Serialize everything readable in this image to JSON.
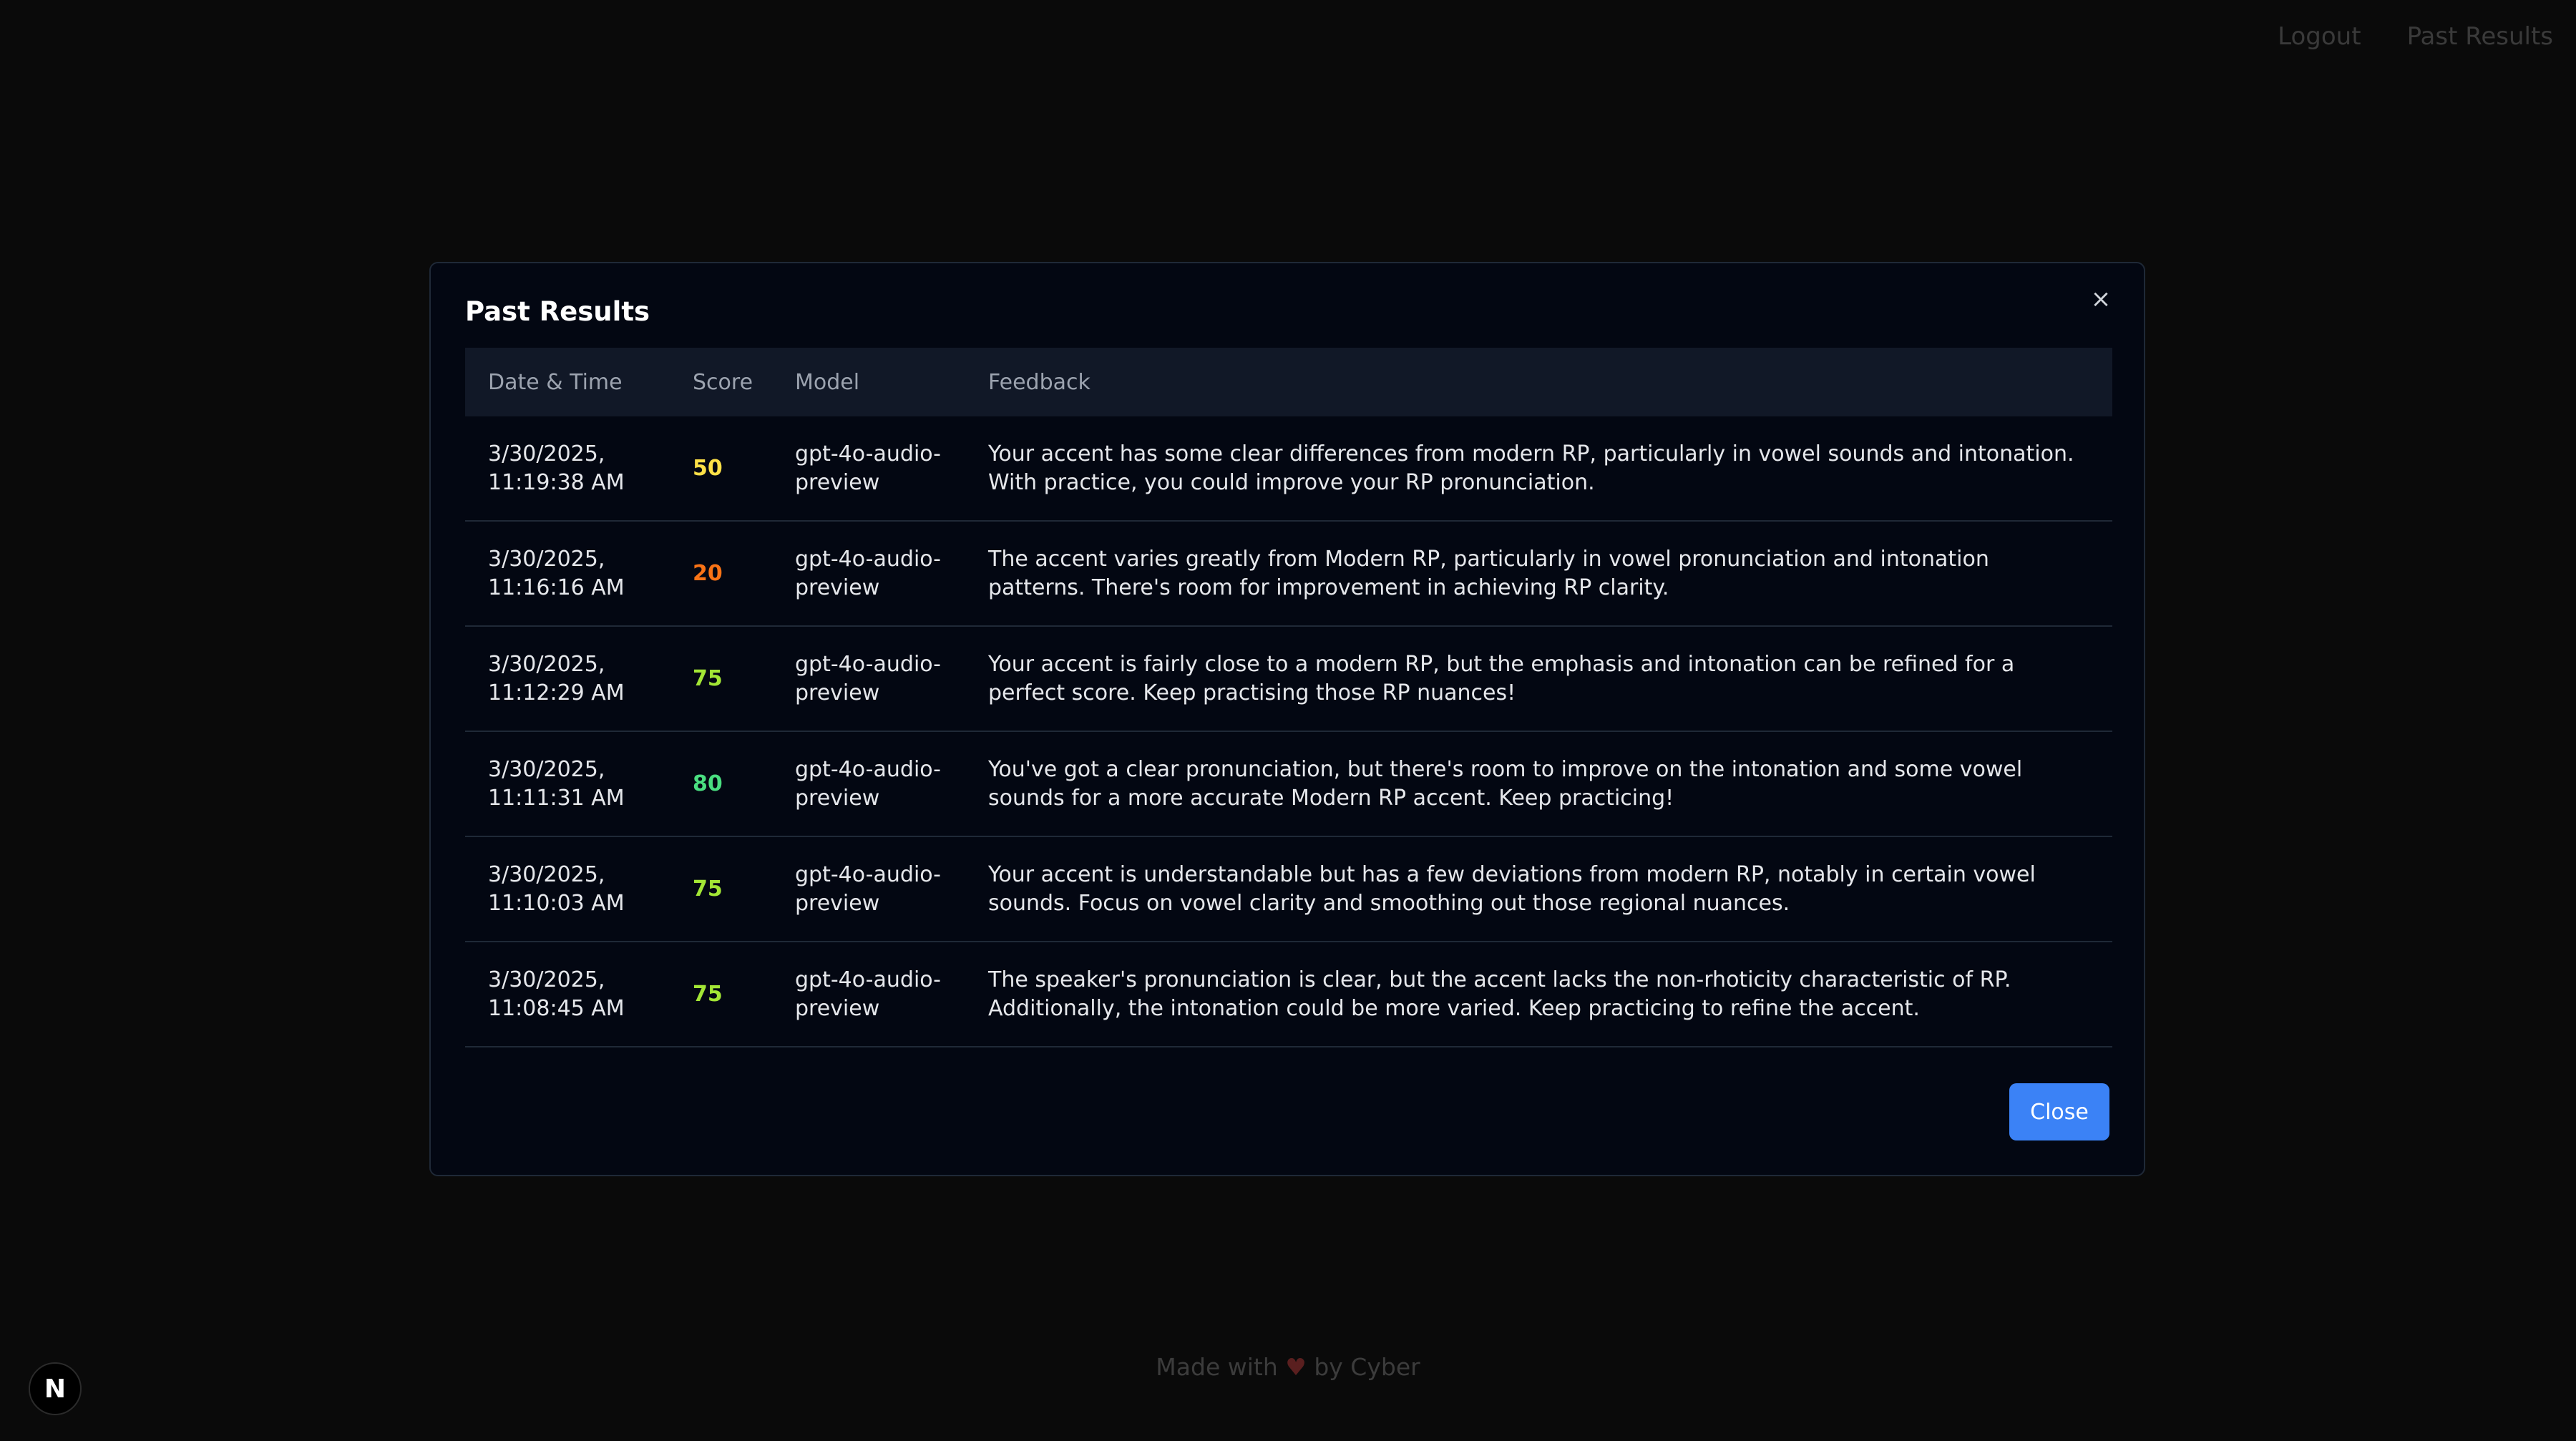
{
  "nav": {
    "logout": "Logout",
    "past_results": "Past Results"
  },
  "modal": {
    "title": "Past Results",
    "close_label": "Close",
    "close_icon": "×"
  },
  "table": {
    "headers": [
      "Date & Time",
      "Score",
      "Model",
      "Feedback"
    ],
    "rows": [
      {
        "datetime": "3/30/2025,\n11:19:38 AM",
        "score": "50",
        "score_color": "#fde047",
        "model": "gpt-4o-audio-\npreview",
        "feedback": "Your accent has some clear differences from modern RP, particularly in vowel sounds and intonation. With practice, you could improve your RP pronunciation."
      },
      {
        "datetime": "3/30/2025,\n11:16:16 AM",
        "score": "20",
        "score_color": "#f97316",
        "model": "gpt-4o-audio-\npreview",
        "feedback": "The accent varies greatly from Modern RP, particularly in vowel pronunciation and intonation patterns. There's room for improvement in achieving RP clarity."
      },
      {
        "datetime": "3/30/2025,\n11:12:29 AM",
        "score": "75",
        "score_color": "#a3e635",
        "model": "gpt-4o-audio-\npreview",
        "feedback": "Your accent is fairly close to a modern RP, but the emphasis and intonation can be refined for a perfect score. Keep practising those RP nuances!"
      },
      {
        "datetime": "3/30/2025,\n11:11:31 AM",
        "score": "80",
        "score_color": "#4ade80",
        "model": "gpt-4o-audio-\npreview",
        "feedback": "You've got a clear pronunciation, but there's room to improve on the intonation and some vowel sounds for a more accurate Modern RP accent. Keep practicing!"
      },
      {
        "datetime": "3/30/2025,\n11:10:03 AM",
        "score": "75",
        "score_color": "#a3e635",
        "model": "gpt-4o-audio-\npreview",
        "feedback": "Your accent is understandable but has a few deviations from modern RP, notably in certain vowel sounds. Focus on vowel clarity and smoothing out those regional nuances."
      },
      {
        "datetime": "3/30/2025,\n11:08:45 AM",
        "score": "75",
        "score_color": "#a3e635",
        "model": "gpt-4o-audio-\npreview",
        "feedback": "The speaker's pronunciation is clear, but the accent lacks the non-rhoticity characteristic of RP. Additionally, the intonation could be more varied. Keep practicing to refine the accent."
      }
    ]
  },
  "footer": {
    "made_with": "Made with",
    "heart": "♥",
    "by": "by Cyber"
  },
  "badge": {
    "letter": "N"
  },
  "colors": {
    "accent": "#3b82f6",
    "background": "#0a0a0a",
    "modal_bg": "#030712"
  }
}
